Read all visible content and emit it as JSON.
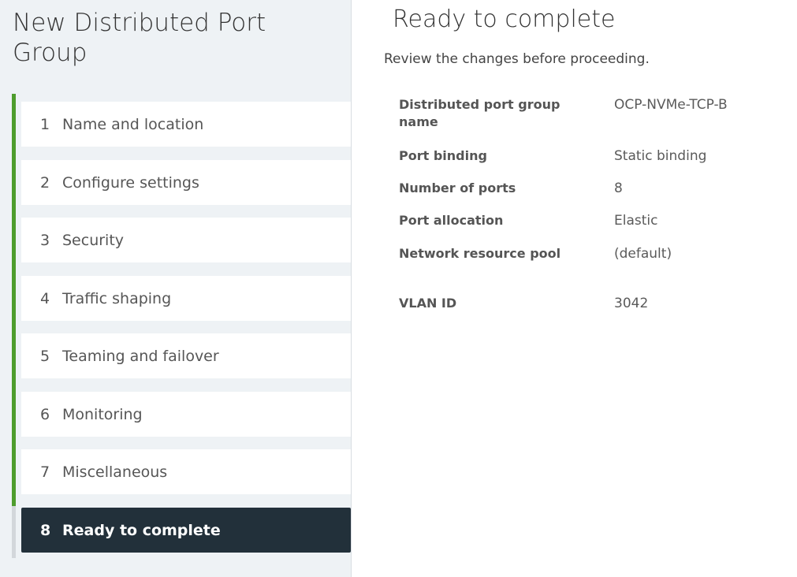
{
  "nav": {
    "title": "New Distributed Port Group",
    "progress_completed_steps": 7,
    "progress_total_steps": 8,
    "steps": [
      {
        "num": "1",
        "label": "Name and location"
      },
      {
        "num": "2",
        "label": "Configure settings"
      },
      {
        "num": "3",
        "label": "Security"
      },
      {
        "num": "4",
        "label": "Traffic shaping"
      },
      {
        "num": "5",
        "label": "Teaming and failover"
      },
      {
        "num": "6",
        "label": "Monitoring"
      },
      {
        "num": "7",
        "label": "Miscellaneous"
      },
      {
        "num": "8",
        "label": "Ready to complete"
      }
    ],
    "active_step": 8
  },
  "main": {
    "title": "Ready to complete",
    "subtitle": "Review the changes before proceeding.",
    "summary": [
      {
        "label": "Distributed port group name",
        "value": "OCP-NVMe-TCP-B"
      },
      {
        "label": "Port binding",
        "value": "Static binding"
      },
      {
        "label": "Number of ports",
        "value": "8"
      },
      {
        "label": "Port allocation",
        "value": "Elastic"
      },
      {
        "label": "Network resource pool",
        "value": "(default)"
      },
      {
        "label": "VLAN ID",
        "value": "3042"
      }
    ]
  },
  "colors": {
    "progress": "#4e9d2d",
    "active_step_bg": "#22303a",
    "nav_bg": "#eef2f5"
  }
}
